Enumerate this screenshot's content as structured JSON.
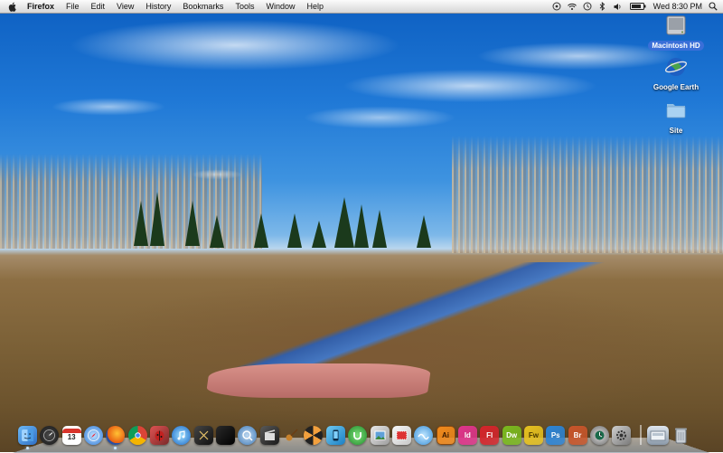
{
  "menubar": {
    "app_name": "Firefox",
    "menus": [
      "File",
      "Edit",
      "View",
      "History",
      "Bookmarks",
      "Tools",
      "Window",
      "Help"
    ],
    "clock": "Wed 8:30 PM",
    "status_icons": [
      "sync-icon",
      "wifi-icon",
      "time-machine-icon",
      "bluetooth-icon",
      "volume-icon",
      "battery-icon",
      "search-icon"
    ]
  },
  "desktop_icons": [
    {
      "label": "Macintosh HD",
      "icon": "hard-drive-icon",
      "selected": true
    },
    {
      "label": "Google Earth",
      "icon": "globe-icon",
      "selected": false
    },
    {
      "label": "Site",
      "icon": "folder-icon",
      "selected": false
    }
  ],
  "dock": {
    "calendar_day": "13",
    "ai_label": "Ai",
    "id_label": "Id",
    "fl_label": "Fl",
    "dw_label": "Dw",
    "fw_label": "Fw",
    "ps_label": "Ps",
    "br_label": "Br",
    "colors": {
      "ai": "#f28a1b",
      "id": "#e0348c",
      "fl": "#d5242b",
      "dw": "#7ab91e",
      "fw": "#e6c11f",
      "ps": "#2b84d6",
      "br": "#c8552a"
    }
  }
}
